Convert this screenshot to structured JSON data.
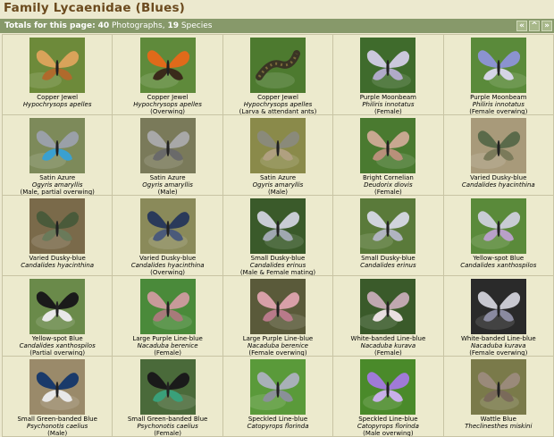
{
  "page": {
    "title": "Family Lycaenidae (Blues)"
  },
  "totals": {
    "label": "Totals for this page:",
    "photographs_count": "40",
    "photographs_label": "Photographs,",
    "species_count": "19",
    "species_label": "Species"
  },
  "nav": {
    "first": "«",
    "up": "^",
    "next": "»"
  },
  "colors": {
    "title": "#6b4a1e",
    "bar": "#87996a",
    "background": "#ece9cf"
  },
  "thumbs": [
    {
      "common": "Copper Jewel",
      "scientific": "Hypochrysops apelles",
      "note": "",
      "bg": "#6d8a3a",
      "wing": "#d9a35a",
      "wing2": "#b06a2c",
      "icon": "butterfly-icon"
    },
    {
      "common": "Copper Jewel",
      "scientific": "Hypochrysops apelles",
      "note": "(Overwing)",
      "bg": "#5f8a3b",
      "wing": "#e06a1a",
      "wing2": "#3a2a1a",
      "icon": "butterfly-icon"
    },
    {
      "common": "Copper Jewel",
      "scientific": "Hypochrysops apelles",
      "note": "(Larva & attendant ants)",
      "bg": "#4d7a2f",
      "wing": "#3a3424",
      "wing2": "#7a6a3a",
      "icon": "larva-icon"
    },
    {
      "common": "Purple Moonbeam",
      "scientific": "Philiris innotatus",
      "note": "(Female)",
      "bg": "#3f6b2c",
      "wing": "#cbc8dc",
      "wing2": "#b0aac8",
      "icon": "butterfly-icon"
    },
    {
      "common": "Purple Moonbeam",
      "scientific": "Philiris innotatus",
      "note": "(Female overwing)",
      "bg": "#5a8a3a",
      "wing": "#8b93d0",
      "wing2": "#d5d5e6",
      "icon": "butterfly-icon"
    },
    {
      "common": "Satin Azure",
      "scientific": "Ogyris amaryllis",
      "note": "(Male, partial overwing)",
      "bg": "#7d8a5a",
      "wing": "#9aa0a8",
      "wing2": "#3aa0d0",
      "icon": "butterfly-icon"
    },
    {
      "common": "Satin Azure",
      "scientific": "Ogyris amaryllis",
      "note": "(Male)",
      "bg": "#7a7a5a",
      "wing": "#a8a8a8",
      "wing2": "#6a6a6a",
      "icon": "butterfly-icon"
    },
    {
      "common": "Satin Azure",
      "scientific": "Ogyris amaryllis",
      "note": "(Male)",
      "bg": "#8a8a4a",
      "wing": "#8a8a7a",
      "wing2": "#b0a080",
      "icon": "butterfly-icon"
    },
    {
      "common": "Bright Cornelian",
      "scientific": "Deudorix diovis",
      "note": "(Female)",
      "bg": "#4a7a30",
      "wing": "#c8a890",
      "wing2": "#b8907a",
      "icon": "butterfly-icon"
    },
    {
      "common": "Varied Dusky-blue",
      "scientific": "Candalides hyacinthina",
      "note": "",
      "bg": "#a89a7a",
      "wing": "#5a6a4a",
      "wing2": "#7a7a5a",
      "icon": "butterfly-icon"
    },
    {
      "common": "Varied Dusky-blue",
      "scientific": "Candalides hyacinthina",
      "note": "",
      "bg": "#7a6a4a",
      "wing": "#4a5a3a",
      "wing2": "#6a7a5a",
      "icon": "butterfly-icon"
    },
    {
      "common": "Varied Dusky-blue",
      "scientific": "Candalides hyacinthina",
      "note": "(Overwing)",
      "bg": "#8a8a5a",
      "wing": "#2a3a5a",
      "wing2": "#4a5a7a",
      "icon": "butterfly-icon"
    },
    {
      "common": "Small Dusky-blue",
      "scientific": "Candalides erinus",
      "note": "(Male & Female mating)",
      "bg": "#3a5a2a",
      "wing": "#c8ccd4",
      "wing2": "#a0a8b0",
      "icon": "butterfly-icon"
    },
    {
      "common": "Small Dusky-blue",
      "scientific": "Candalides erinus",
      "note": "",
      "bg": "#5a7a3a",
      "wing": "#d0d4dc",
      "wing2": "#b0b4c0",
      "icon": "butterfly-icon"
    },
    {
      "common": "Yellow-spot Blue",
      "scientific": "Candalides xanthospilos",
      "note": "",
      "bg": "#5a8a3a",
      "wing": "#c8ccd4",
      "wing2": "#b8a0c8",
      "icon": "butterfly-icon"
    },
    {
      "common": "Yellow-spot Blue",
      "scientific": "Candalides xanthospilos",
      "note": "(Partial overwing)",
      "bg": "#6a8a4a",
      "wing": "#1a1a1a",
      "wing2": "#e8e8e8",
      "icon": "butterfly-icon"
    },
    {
      "common": "Large Purple Line-blue",
      "scientific": "Nacaduba berenice",
      "note": "(Female)",
      "bg": "#4a8a3a",
      "wing": "#c89a9a",
      "wing2": "#a87a7a",
      "icon": "butterfly-icon"
    },
    {
      "common": "Large Purple Line-blue",
      "scientific": "Nacaduba berenice",
      "note": "(Female overwing)",
      "bg": "#5a5a3a",
      "wing": "#d8a0a8",
      "wing2": "#b87a8a",
      "icon": "butterfly-icon"
    },
    {
      "common": "White-banded Line-blue",
      "scientific": "Nacaduba kurava",
      "note": "(Female)",
      "bg": "#3a5a2a",
      "wing": "#c0a8b0",
      "wing2": "#e8e0e0",
      "icon": "butterfly-icon"
    },
    {
      "common": "White-banded Line-blue",
      "scientific": "Nacaduba kurava",
      "note": "(Female overwing)",
      "bg": "#2a2a2a",
      "wing": "#c8c8d0",
      "wing2": "#8a8aa0",
      "icon": "butterfly-icon"
    },
    {
      "common": "Small Green-banded Blue",
      "scientific": "Psychonotis caelius",
      "note": "(Male)",
      "bg": "#9a8a6a",
      "wing": "#1a3a6a",
      "wing2": "#e8e8e8",
      "icon": "butterfly-icon"
    },
    {
      "common": "Small Green-banded Blue",
      "scientific": "Psychonotis caelius",
      "note": "(Female)",
      "bg": "#4a6a3a",
      "wing": "#1a1a1a",
      "wing2": "#3aa07a",
      "icon": "butterfly-icon"
    },
    {
      "common": "Speckled Line-blue",
      "scientific": "Catopyrops florinda",
      "note": "",
      "bg": "#5a9a3a",
      "wing": "#a8b0b8",
      "wing2": "#8a9098",
      "icon": "butterfly-icon"
    },
    {
      "common": "Speckled Line-blue",
      "scientific": "Catopyrops florinda",
      "note": "(Male overwing)",
      "bg": "#4a8a2a",
      "wing": "#a07ad8",
      "wing2": "#c8b0e8",
      "icon": "butterfly-icon"
    },
    {
      "common": "Wattle Blue",
      "scientific": "Theclinesthes miskini",
      "note": "",
      "bg": "#7a7a4a",
      "wing": "#9a8a7a",
      "wing2": "#7a6a5a",
      "icon": "butterfly-icon"
    }
  ]
}
